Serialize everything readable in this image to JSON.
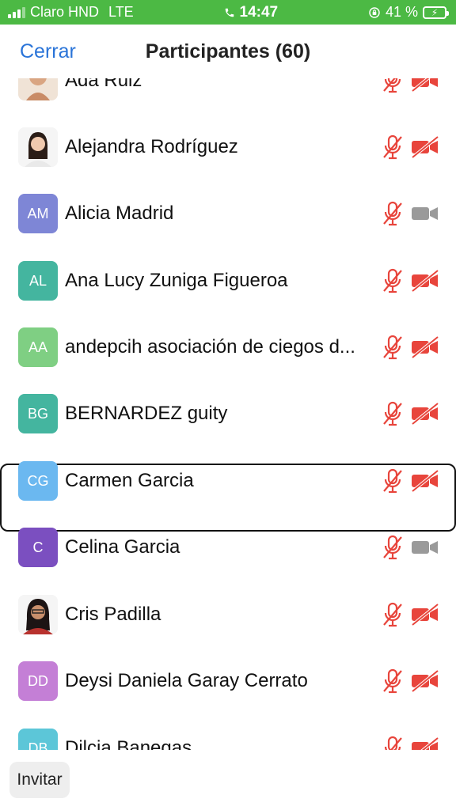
{
  "status_bar": {
    "carrier": "Claro HND",
    "network": "LTE",
    "time": "14:47",
    "battery_text": "41 %",
    "phone_icon": "phone-icon",
    "orientation_lock_icon": "orientation-lock-icon"
  },
  "header": {
    "close_label": "Cerrar",
    "title": "Participantes (60)"
  },
  "colors": {
    "status_bar": "#4cb944",
    "accent": "#2a74d8",
    "muted_red": "#e8453c",
    "camera_on_gray": "#9a9a9a"
  },
  "participants": [
    {
      "name": "Ada Ruiz",
      "initials": "",
      "avatar_type": "photo",
      "avatar_color": "#e8c7a8",
      "mic": "muted",
      "camera": "off"
    },
    {
      "name": "Alejandra Rodríguez",
      "initials": "",
      "avatar_type": "photo",
      "avatar_color": "#f3f3f3",
      "mic": "muted",
      "camera": "off"
    },
    {
      "name": "Alicia Madrid",
      "initials": "AM",
      "avatar_type": "initials",
      "avatar_color": "#7e86d6",
      "mic": "muted",
      "camera": "on"
    },
    {
      "name": "Ana Lucy Zuniga Figueroa",
      "initials": "AL",
      "avatar_type": "initials",
      "avatar_color": "#44b59f",
      "mic": "muted",
      "camera": "off"
    },
    {
      "name": "andepcih asociación de ciegos d...",
      "initials": "AA",
      "avatar_type": "initials",
      "avatar_color": "#7fcf83",
      "mic": "muted",
      "camera": "off"
    },
    {
      "name": "BERNARDEZ guity",
      "initials": "BG",
      "avatar_type": "initials",
      "avatar_color": "#44b59f",
      "mic": "muted",
      "camera": "off"
    },
    {
      "name": "Carmen Garcia",
      "initials": "CG",
      "avatar_type": "initials",
      "avatar_color": "#6bb8f0",
      "mic": "muted",
      "camera": "off",
      "selected": true
    },
    {
      "name": "Celina Garcia",
      "initials": "C",
      "avatar_type": "initials",
      "avatar_color": "#7b4fc0",
      "mic": "muted",
      "camera": "on"
    },
    {
      "name": "Cris Padilla",
      "initials": "",
      "avatar_type": "photo",
      "avatar_color": "#f3f3f3",
      "mic": "muted",
      "camera": "off"
    },
    {
      "name": "Deysi Daniela Garay Cerrato",
      "initials": "DD",
      "avatar_type": "initials",
      "avatar_color": "#c47fd6",
      "mic": "muted",
      "camera": "off"
    },
    {
      "name": "Dilcia Banegas",
      "initials": "DB",
      "avatar_type": "initials",
      "avatar_color": "#5cc6d8",
      "mic": "muted",
      "camera": "off"
    }
  ],
  "footer": {
    "invite_label": "Invitar"
  }
}
